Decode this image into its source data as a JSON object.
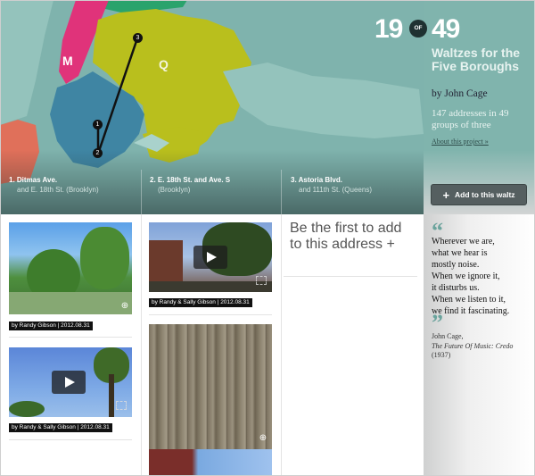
{
  "counter": {
    "current": "19",
    "of_label": "OF",
    "total": "49"
  },
  "title": "Waltzes for the Five Boroughs",
  "author": "by John Cage",
  "summary": "147 addresses in 49 groups of three",
  "about_link": "About this project »",
  "add_button": "Add to this waltz",
  "map": {
    "borough_labels": [
      "M",
      "Q"
    ],
    "stops": [
      {
        "number": "1.",
        "line1": "Ditmas Ave.",
        "line2": "and E. 18th St. (Brooklyn)"
      },
      {
        "number": "2.",
        "line1": "E. 18th St. and Ave. S",
        "line2": "(Brooklyn)"
      },
      {
        "number": "3.",
        "line1": "Astoria Blvd.",
        "line2": "and 111th St. (Queens)"
      }
    ],
    "markers": [
      "1",
      "2",
      "3"
    ],
    "colors": {
      "water": "#7fb3ad",
      "manhattan": "#e0337a",
      "queens": "#b9bf1d",
      "brooklyn": "#3f85a3",
      "staten": "#e0705a",
      "bronx": "#2aa36c"
    }
  },
  "media": {
    "col1": [
      {
        "caption": "by Randy Gibson | 2012.08.31",
        "type": "photo"
      },
      {
        "caption": "by Randy & Sally Gibson | 2012.08.31",
        "type": "video"
      }
    ],
    "col2": [
      {
        "caption": "by Randy & Sally Gibson | 2012.08.31",
        "type": "video"
      },
      {
        "caption": "",
        "type": "photo"
      }
    ]
  },
  "cta": "Be the first to add to this address +",
  "quote": {
    "lines": [
      "Wherever we are,",
      "what we hear is",
      "mostly noise.",
      "When we ignore it,",
      "it disturbs us.",
      "When we listen to it,",
      "we find it fascinating."
    ],
    "author": "John Cage,",
    "source": "The Future Of Music: Credo",
    "year": "(1937)"
  }
}
